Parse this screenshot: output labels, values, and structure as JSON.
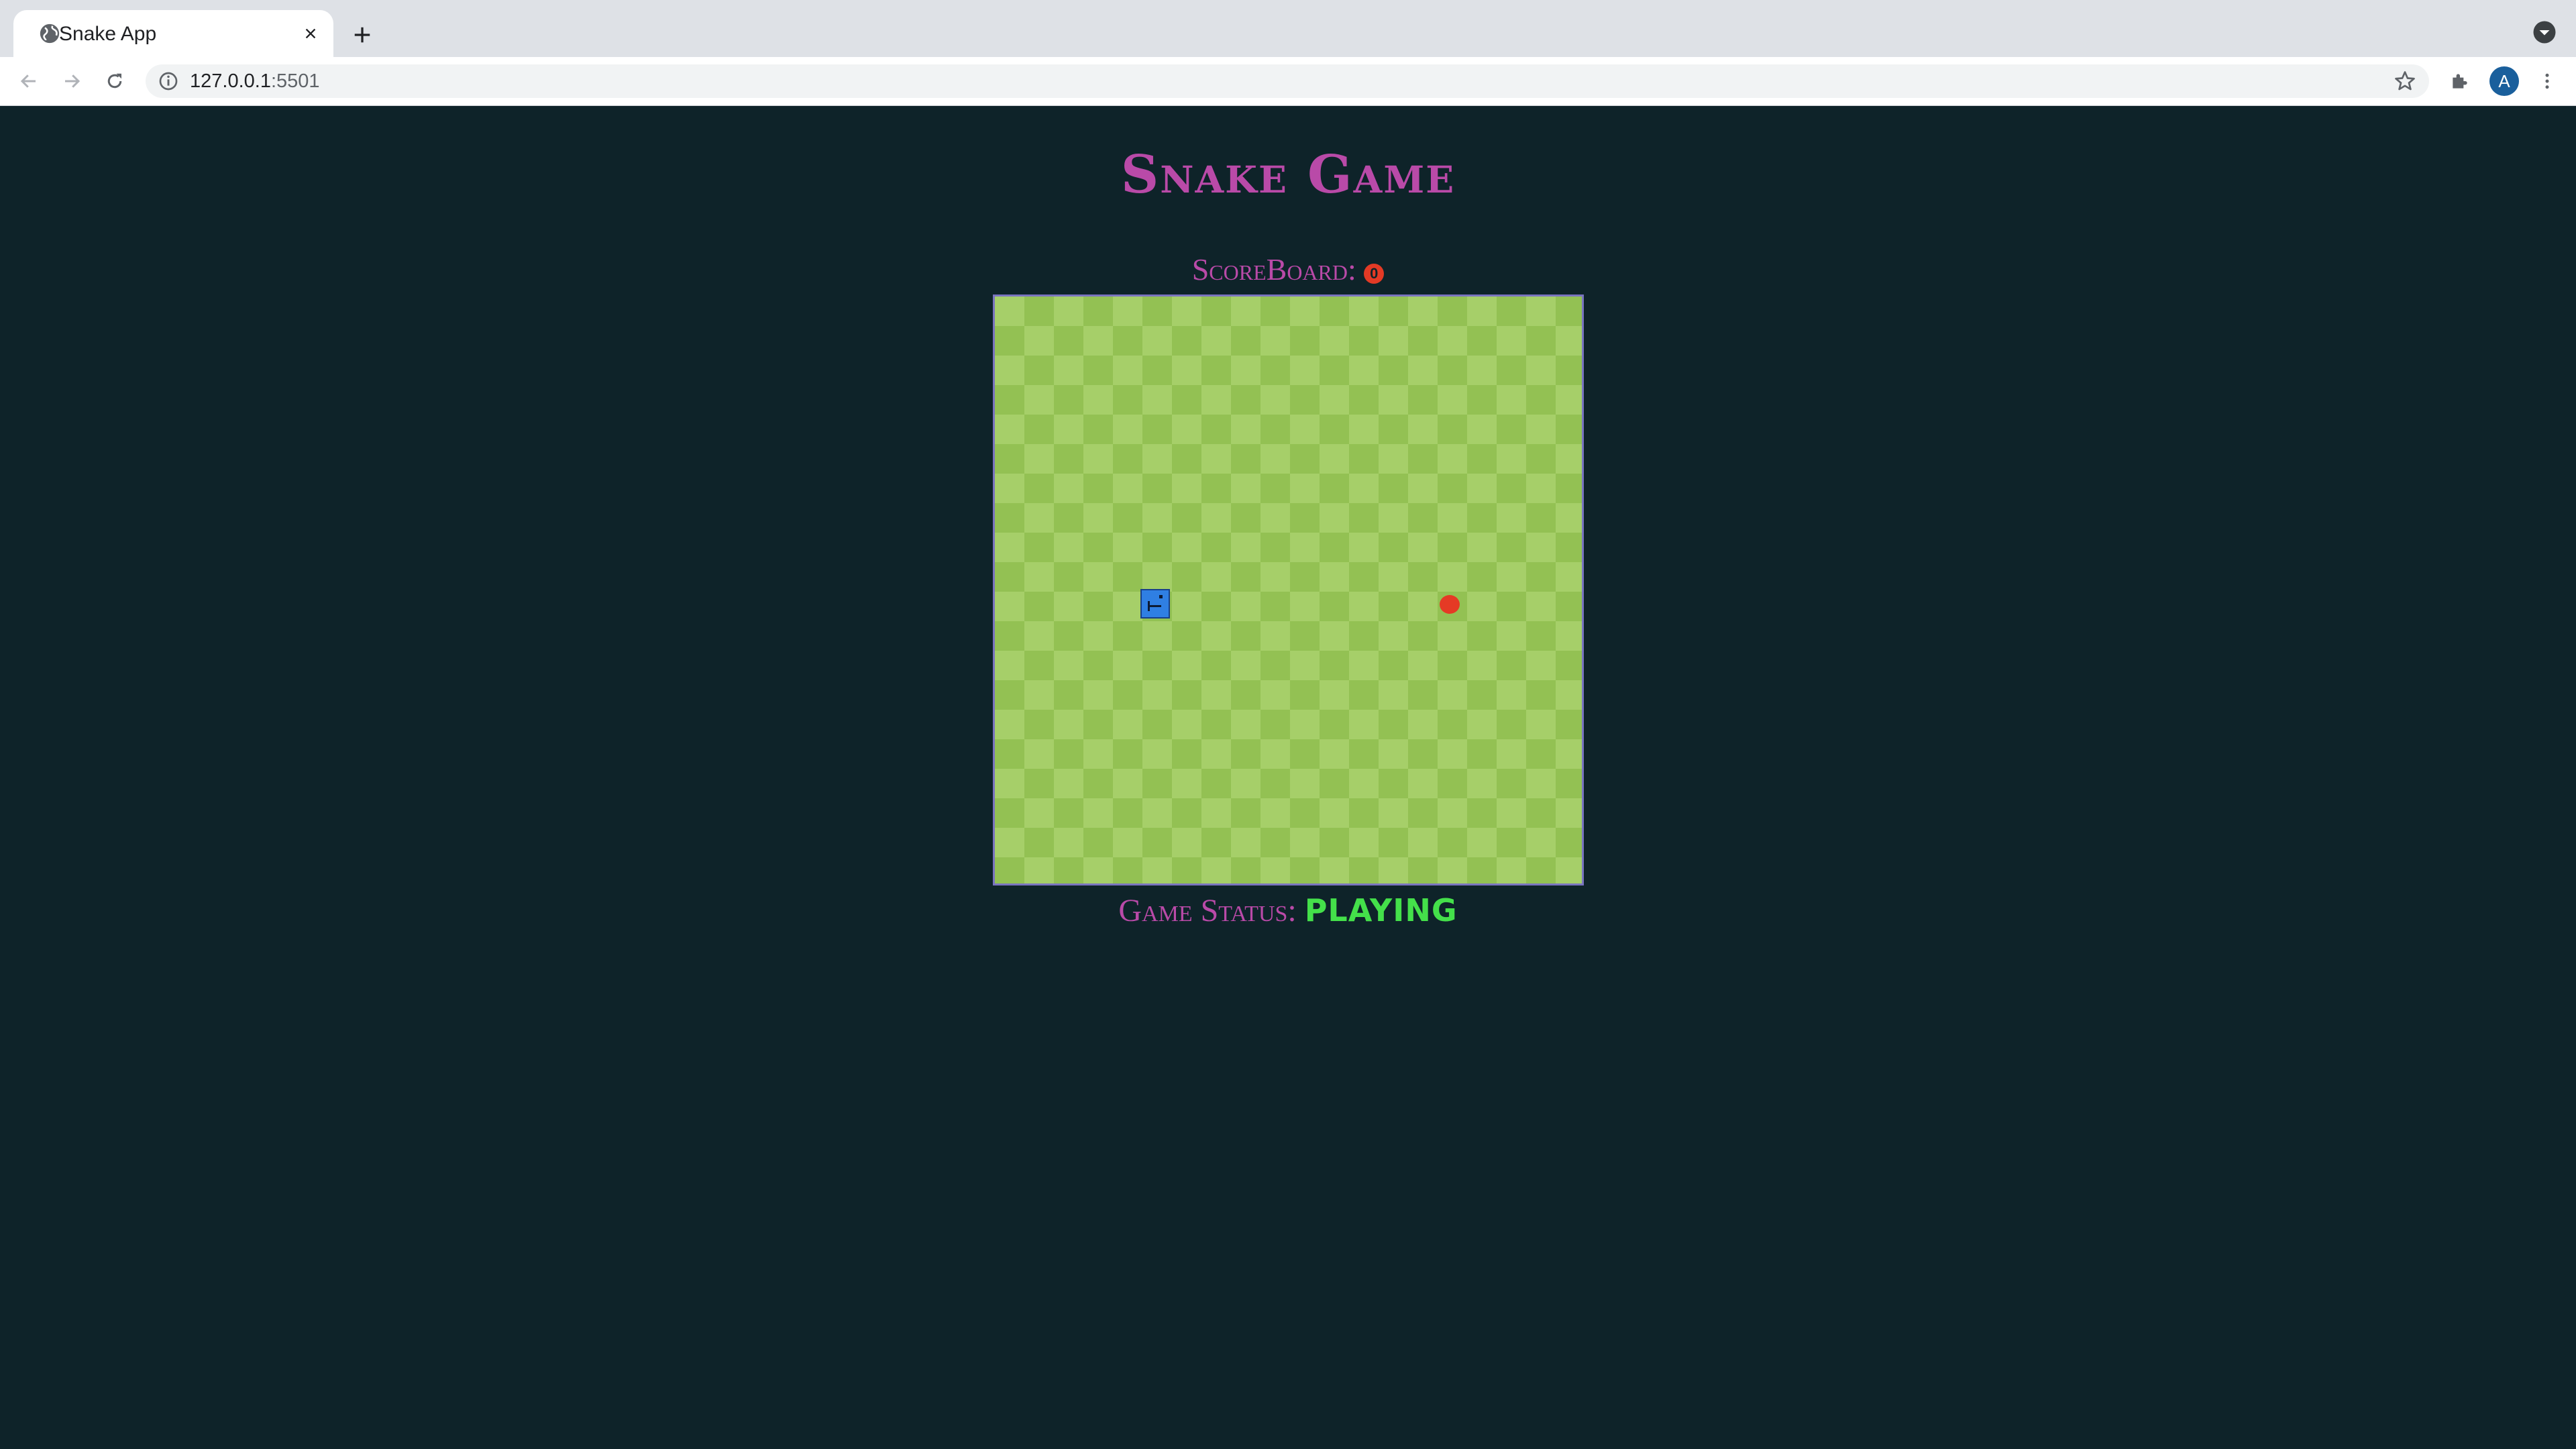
{
  "browser": {
    "tab": {
      "title": "Snake App",
      "favicon": "globe-icon",
      "close_icon": "close-icon"
    },
    "new_tab_icon": "plus-icon",
    "tab_search_icon": "chevron-down-icon",
    "toolbar": {
      "back_icon": "arrow-left-icon",
      "forward_icon": "arrow-right-icon",
      "reload_icon": "reload-icon",
      "info_icon": "info-icon",
      "url_host": "127.0.0.1",
      "url_port": ":5501",
      "bookmark_icon": "star-icon",
      "extensions_icon": "puzzle-icon",
      "profile_initial": "A",
      "menu_icon": "kebab-menu-icon"
    }
  },
  "game": {
    "title": "Snake Game",
    "scoreboard_label": "ScoreBoard:",
    "score": "0",
    "status_label": "Game Status:",
    "status": "PLAYING",
    "grid_size": 20,
    "snake_head_icon": "snake-head",
    "food_icon": "apple-food"
  },
  "colors": {
    "background": "#0e2329",
    "title": "#b94aa8",
    "board_light": "#a6cf69",
    "board_dark": "#93c153",
    "board_border": "#7a74bf",
    "snake": "#2f7fe3",
    "food": "#e53a25",
    "status_playing": "#44e04a"
  }
}
